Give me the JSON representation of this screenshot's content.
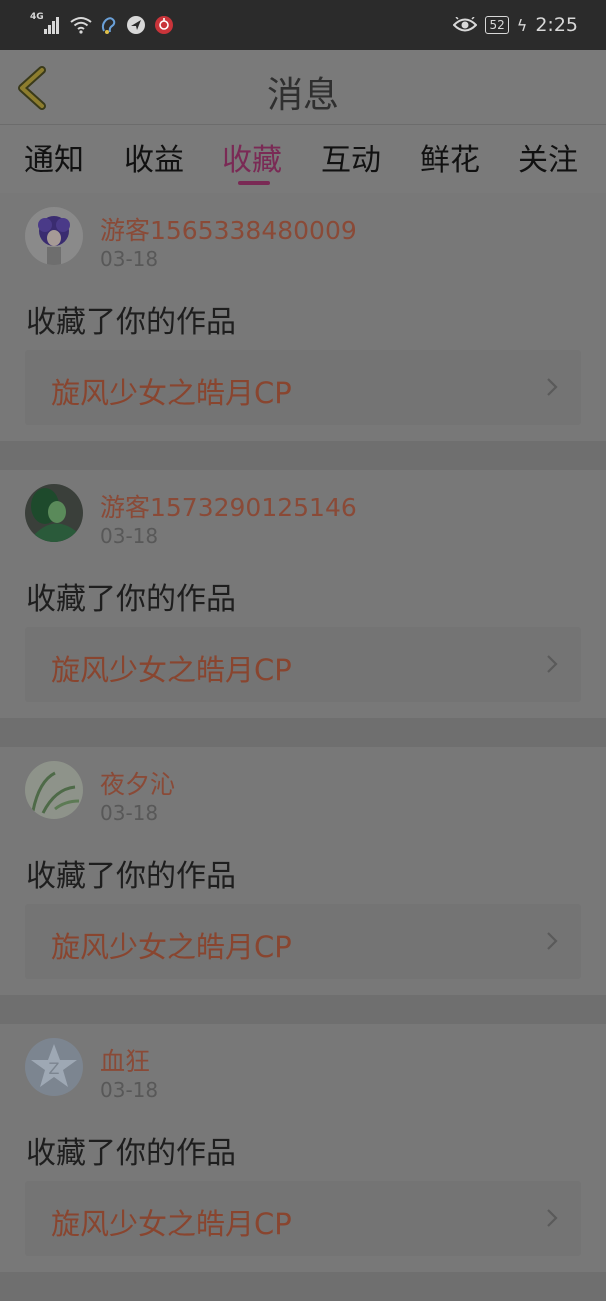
{
  "status_bar": {
    "network": "4G",
    "battery": "52",
    "time": "2:25"
  },
  "header": {
    "title": "消息"
  },
  "tabs": [
    {
      "label": "通知"
    },
    {
      "label": "收益"
    },
    {
      "label": "收藏"
    },
    {
      "label": "互动"
    },
    {
      "label": "鲜花"
    },
    {
      "label": "关注"
    }
  ],
  "active_tab": "收藏",
  "items": [
    {
      "username": "游客1565338480009",
      "date": "03-18",
      "action": "收藏了你的作品",
      "work": "旋风少女之皓月CP"
    },
    {
      "username": "游客1573290125146",
      "date": "03-18",
      "action": "收藏了你的作品",
      "work": "旋风少女之皓月CP"
    },
    {
      "username": "夜夕沁",
      "date": "03-18",
      "action": "收藏了你的作品",
      "work": "旋风少女之皓月CP"
    },
    {
      "username": "血狂",
      "date": "03-18",
      "action": "收藏了你的作品",
      "work": "旋风少女之皓月CP"
    }
  ],
  "colors": {
    "accent": "#7a2a55",
    "username": "#8a4a37",
    "work_title": "#89452f"
  }
}
